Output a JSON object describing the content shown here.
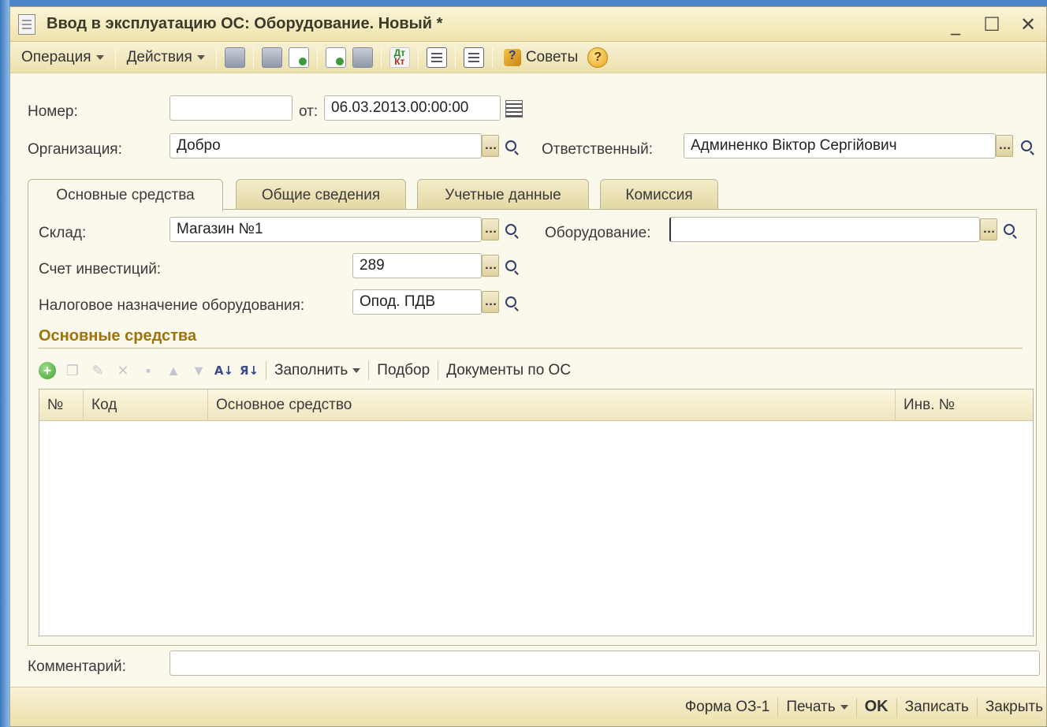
{
  "window": {
    "title": "Ввод в эксплуатацию ОС: Оборудование. Новый *",
    "controls": {
      "minimize": "_",
      "maximize": "☐",
      "close": "✕"
    }
  },
  "toolbar": {
    "operation_label": "Операция",
    "actions_label": "Действия",
    "tips_label": "Советы",
    "help_label": "?",
    "dtkt_top": "Дт",
    "dtkt_bottom": "Кт"
  },
  "header": {
    "number_label": "Номер:",
    "number_value": "",
    "date_from_label": "от:",
    "date_value": "06.03.2013.00:00:00",
    "organization_label": "Организация:",
    "organization_value": "Добро",
    "responsible_label": "Ответственный:",
    "responsible_value": "Админенко Віктор Сергійович"
  },
  "tabs": [
    {
      "label": "Основные средства",
      "active": true
    },
    {
      "label": "Общие сведения",
      "active": false
    },
    {
      "label": "Учетные данные",
      "active": false
    },
    {
      "label": "Комиссия",
      "active": false
    }
  ],
  "main_tab": {
    "warehouse_label": "Склад:",
    "warehouse_value": "Магазин №1",
    "equipment_label": "Оборудование:",
    "equipment_value": "",
    "investment_account_label": "Счет инвестиций:",
    "investment_account_value": "289",
    "tax_purpose_label": "Налоговое назначение оборудования:",
    "tax_purpose_value": "Опод. ПДВ"
  },
  "fixed_assets": {
    "section_title": "Основные средства",
    "toolbar": {
      "fill_label": "Заполнить",
      "selection_label": "Подбор",
      "documents_label": "Документы по ОС"
    },
    "columns": [
      "№",
      "Код",
      "Основное средство",
      "Инв. №"
    ],
    "rows": []
  },
  "comment": {
    "label": "Комментарий:",
    "value": ""
  },
  "bottom": {
    "form_label": "Форма ОЗ-1",
    "print_label": "Печать",
    "ok_label": "OK",
    "save_label": "Записать",
    "close_label": "Закрыть"
  },
  "colors": {
    "section_title": "#a0720a",
    "toolbar_bg": "#ece0ad",
    "window_bg": "#fbf8ec"
  }
}
